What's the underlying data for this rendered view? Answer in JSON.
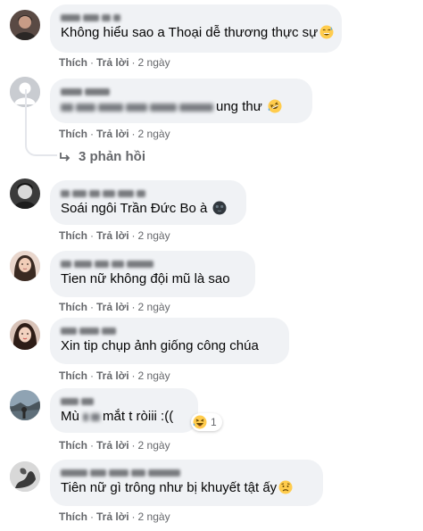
{
  "comments": [
    {
      "author": "",
      "text": "Không hiểu sao a Thoại dễ thương thực sự",
      "emoji": "grinning-sweat",
      "like": "Thích",
      "reply": "Trả lời",
      "time": "2 ngày"
    },
    {
      "author": "",
      "text_suffix": "ung thư",
      "emoji": "rofl",
      "like": "Thích",
      "reply": "Trả lời",
      "time": "2 ngày",
      "replies_label": "3 phản hồi"
    },
    {
      "author": "",
      "text": "Soái ngôi Trần Đức Bo à",
      "emoji": "new-moon-face",
      "like": "Thích",
      "reply": "Trả lời",
      "time": "2 ngày"
    },
    {
      "author": "",
      "text": "Tien nữ không đội mũ là sao",
      "like": "Thích",
      "reply": "Trả lời",
      "time": "2 ngày"
    },
    {
      "author": "",
      "text": "Xin tip chụp ảnh giống công chúa",
      "like": "Thích",
      "reply": "Trả lời",
      "time": "2 ngày"
    },
    {
      "author": "",
      "text_prefix": "Mù",
      "text_suffix": "mắt t ròiii :((",
      "reaction": "haha",
      "reaction_count": "1",
      "like": "Thích",
      "reply": "Trả lời",
      "time": "2 ngày"
    },
    {
      "author": "",
      "text": "Tiên nữ gì trông như bị khuyết tật ấy",
      "emoji": "sad-face",
      "like": "Thích",
      "reply": "Trả lời",
      "time": "2 ngày"
    }
  ],
  "colors": {
    "bubble": "#f0f2f5",
    "meta_text": "#65676b",
    "body_text": "#050505",
    "emoji_yellow": "#ffcc4d"
  }
}
